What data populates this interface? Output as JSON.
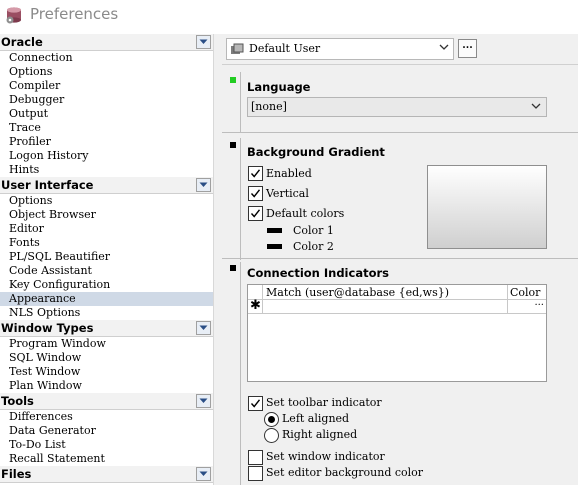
{
  "window": {
    "title": "Preferences"
  },
  "sidebar": {
    "sections": [
      {
        "label": "Oracle",
        "items": [
          "Connection",
          "Options",
          "Compiler",
          "Debugger",
          "Output",
          "Trace",
          "Profiler",
          "Logon History",
          "Hints"
        ]
      },
      {
        "label": "User Interface",
        "items": [
          "Options",
          "Object Browser",
          "Editor",
          "Fonts",
          "PL/SQL Beautifier",
          "Code Assistant",
          "Key Configuration",
          "Appearance",
          "NLS Options"
        ]
      },
      {
        "label": "Window Types",
        "items": [
          "Program Window",
          "SQL Window",
          "Test Window",
          "Plan Window"
        ]
      },
      {
        "label": "Tools",
        "items": [
          "Differences",
          "Data Generator",
          "To-Do List",
          "Recall Statement"
        ]
      },
      {
        "label": "Files",
        "items": []
      }
    ],
    "selected": "Appearance"
  },
  "profile": {
    "user": "Default User",
    "more_label": "..."
  },
  "language": {
    "title": "Language",
    "value": "[none]"
  },
  "gradient": {
    "title": "Background Gradient",
    "enabled_label": "Enabled",
    "enabled": true,
    "vertical_label": "Vertical",
    "vertical": true,
    "default_colors_label": "Default colors",
    "default_colors": true,
    "color1_label": "Color 1",
    "color2_label": "Color 2"
  },
  "connection": {
    "title": "Connection Indicators",
    "col_match": "Match (user@database {ed,ws})",
    "col_color": "Color",
    "new_row_marker": "✱",
    "row_button": "...",
    "set_toolbar_label": "Set toolbar indicator",
    "set_toolbar": true,
    "left_aligned_label": "Left aligned",
    "right_aligned_label": "Right aligned",
    "alignment": "left",
    "set_window_label": "Set window indicator",
    "set_window": false,
    "set_editor_bg_label": "Set editor background color",
    "set_editor_bg": false
  },
  "colors": {
    "accent_marker": "#22cc22",
    "selected_bg": "#cfd9e6"
  }
}
